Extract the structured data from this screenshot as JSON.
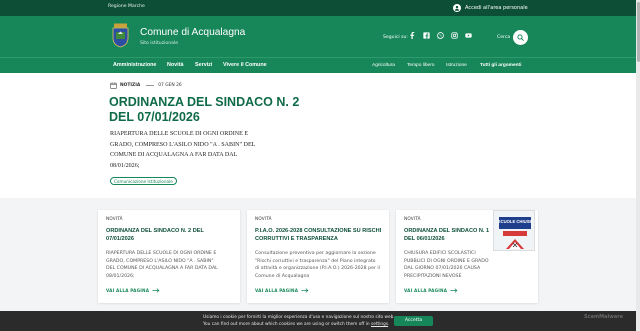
{
  "topbar": {
    "region_link": "Regione Marche",
    "login_label": "Accedi all'area personale"
  },
  "header": {
    "title": "Comune di Acqualagna",
    "subtitle": "Sito istituzionale",
    "follow_label": "Seguici su:",
    "socials": [
      "facebook-icon",
      "facebook-square-icon",
      "whatsapp-icon",
      "instagram-icon",
      "youtube-icon"
    ],
    "search_label": "Cerca"
  },
  "nav": {
    "main": [
      "Amministrazione",
      "Novità",
      "Servizi",
      "Vivere il Comune"
    ],
    "secondary": [
      "Agricoltura",
      "Tempo libero",
      "Istruzione"
    ],
    "all_topics": "Tutti gli argomenti"
  },
  "article": {
    "tag": "NOTIZIA",
    "date": "07 GEN 26",
    "title": "ORDINANZA DEL SINDACO N. 2 DEL 07/01/2026",
    "description": "RIAPERTURA DELLE SCUOLE DI OGNI ORDINE E GRADO, COMPRESO L'ASILO NIDO \"A . SABIN\" DEL COMUNE DI ACQUALAGNA A FAR DATA DAL 08/01/2026;",
    "chip": "Comunicazione Istituzionale"
  },
  "cards": [
    {
      "category": "NOVITÀ",
      "title": "ORDINANZA DEL SINDACO N. 2 DEL 07/01/2026",
      "text": "RIAPERTURA DELLE SCUOLE DI OGNI ORDINE E GRADO, COMPRESO L'ASILO NIDO \"A . SABIN\" DEL COMUNE DI ACQUALAGNA A FAR DATA DAL 08/01/2026;",
      "more": "VAI ALLA PAGINA"
    },
    {
      "category": "NOVITÀ",
      "title": "P.I.A.O. 2026-2028 CONSULTAZIONE SU RISCHI CORRUTTIVI E TRASPARENZA",
      "text": "Consultazione preventiva per aggiornare la sezione \"Rischi corruttivi e trasparenza\" del Piano integrato di attività e organizzazione (P.I.A.O.) 2026-2028 per il Comune di Acqualagna",
      "more": "VAI ALLA PAGINA"
    },
    {
      "category": "NOVITÀ",
      "title": "ORDINANZA DEL SINDACO N. 1 DEL 06/01/2026",
      "text": "CHIUSURA EDIFICI SCOLASTICI PUBBLICI DI OGNI ORDINE E GRADO DAL GIORNO 07/01/2026 CAUSA PRECIPITAZIONI NEVOSE",
      "more": "VAI ALLA PAGINA",
      "thumb_caption": "SCUOLE CHIUSE"
    }
  ],
  "cookie": {
    "line1": "Usiamo i cookie per fornirti la miglior esperienza d'uso e navigazione sul nostro sito web.",
    "line2_prefix": "You can find out more about which cookies we are using or switch them off in ",
    "line2_link": "settings",
    "line2_suffix": ".",
    "accept": "Accetta"
  },
  "watermark": "ScamMalware",
  "colors": {
    "primary": "#17875a",
    "dark": "#0d4f36",
    "title": "#0f6b47"
  }
}
